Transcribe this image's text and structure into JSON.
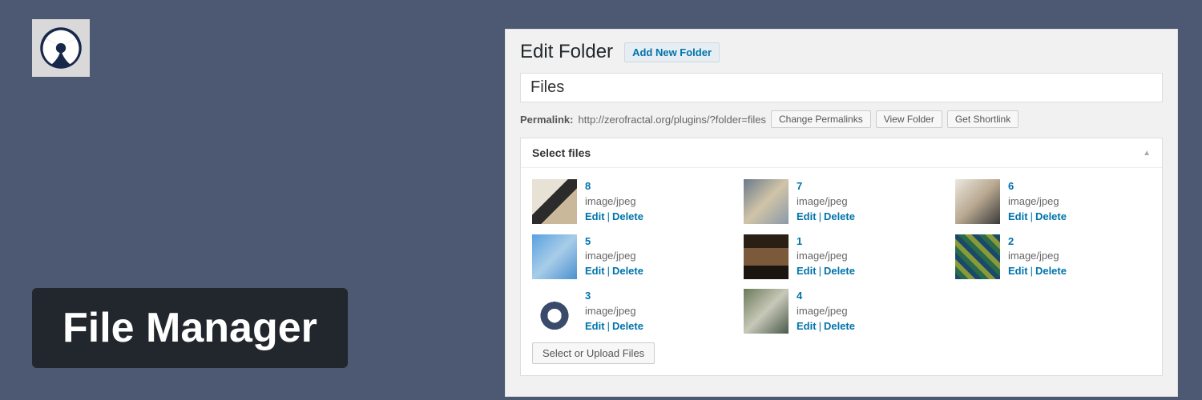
{
  "banner": {
    "title": "File Manager"
  },
  "panel": {
    "heading": "Edit Folder",
    "add_button": "Add New Folder",
    "folder_name": "Files",
    "permalink_label": "Permalink:",
    "permalink_url": "http://zerofractal.org/plugins/?folder=files",
    "buttons": {
      "change_permalinks": "Change Permalinks",
      "view_folder": "View Folder",
      "get_shortlink": "Get Shortlink"
    },
    "metabox_title": "Select files",
    "select_upload": "Select or Upload Files",
    "actions": {
      "edit": "Edit",
      "delete": "Delete"
    },
    "files": [
      {
        "name": "8",
        "mime": "image/jpeg",
        "thumb": "t8"
      },
      {
        "name": "7",
        "mime": "image/jpeg",
        "thumb": "t7"
      },
      {
        "name": "6",
        "mime": "image/jpeg",
        "thumb": "t6"
      },
      {
        "name": "5",
        "mime": "image/jpeg",
        "thumb": "t5"
      },
      {
        "name": "1",
        "mime": "image/jpeg",
        "thumb": "t1"
      },
      {
        "name": "2",
        "mime": "image/jpeg",
        "thumb": "t2"
      },
      {
        "name": "3",
        "mime": "image/jpeg",
        "thumb": "t3"
      },
      {
        "name": "4",
        "mime": "image/jpeg",
        "thumb": "t4"
      }
    ]
  }
}
